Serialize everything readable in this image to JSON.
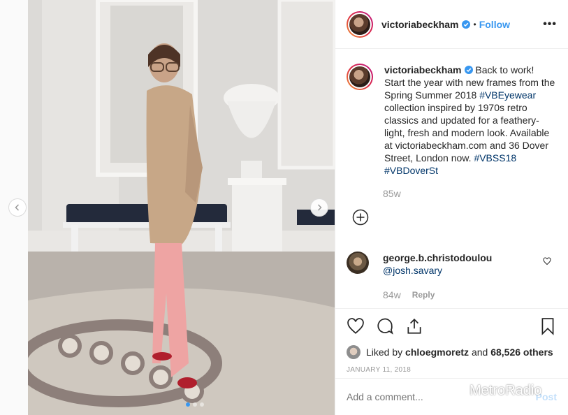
{
  "post": {
    "author": "victoriabeckham",
    "follow_label": "Follow",
    "more_label": "•••",
    "separator": "•"
  },
  "caption": {
    "username": "victoriabeckham",
    "text_1": "Back to work! Start the year with new frames from the Spring Summer 2018 ",
    "tag_1": "#VBEyewear",
    "text_2": " collection inspired by 1970s retro classics and updated for a feathery-light, fresh and modern look. Available at victoriabeckham.com and 36 Dover Street, London now. ",
    "tag_2": "#VBSS18",
    "tag_3": "#VBDoverSt",
    "age": "85w"
  },
  "comment": {
    "username": "george.b.christodoulou",
    "mention": "@josh.savary",
    "age": "84w",
    "reply_label": "Reply"
  },
  "likes": {
    "prefix": "Liked by ",
    "user": "chloegmoretz",
    "middle": " and ",
    "count": "68,526 others",
    "date": "JANUARY 11, 2018"
  },
  "composer": {
    "placeholder": "Add a comment...",
    "post_label": "Post"
  },
  "carousel": {
    "slides": 3,
    "active_index": 0
  },
  "watermark": {
    "text": "MetroRadio"
  },
  "colors": {
    "link": "#3897f0",
    "hashtag": "#003569",
    "muted": "#999999",
    "text": "#262626"
  }
}
